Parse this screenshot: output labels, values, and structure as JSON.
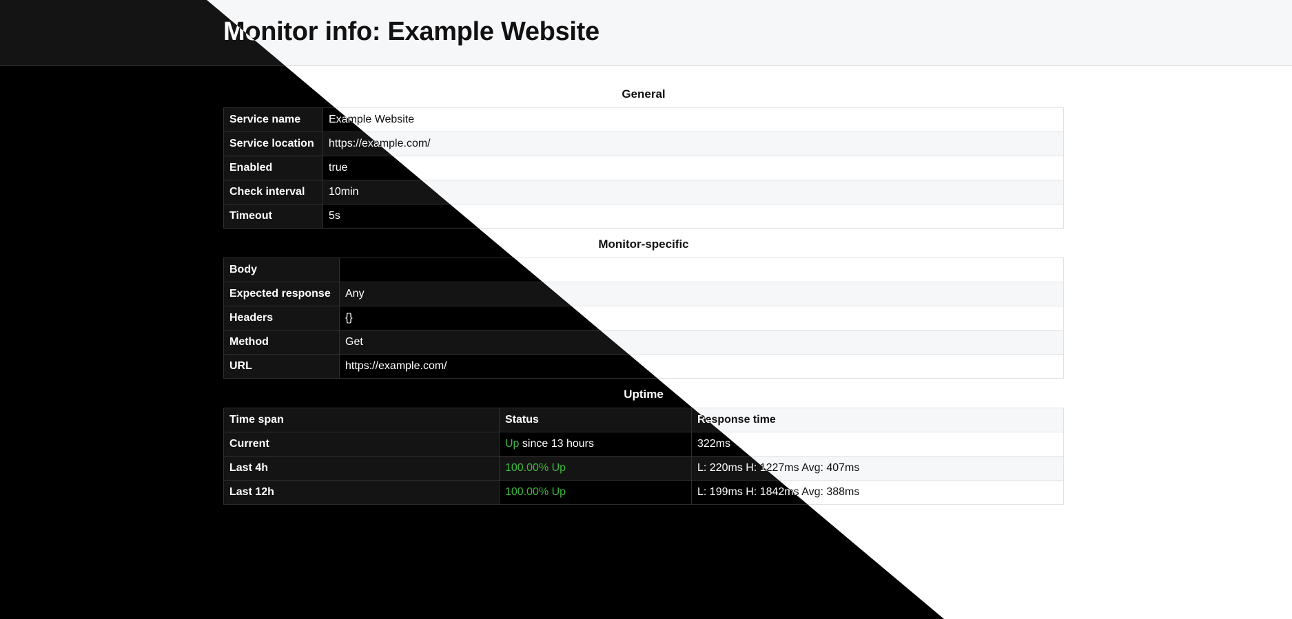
{
  "page": {
    "title": "Monitor info: Example Website"
  },
  "general": {
    "heading": "General",
    "rows": [
      {
        "label": "Service name",
        "value": "Example Website"
      },
      {
        "label": "Service location",
        "value": "https://example.com/"
      },
      {
        "label": "Enabled",
        "value": "true"
      },
      {
        "label": "Check interval",
        "value": "10min"
      },
      {
        "label": "Timeout",
        "value": "5s"
      }
    ]
  },
  "monitor_specific": {
    "heading": "Monitor-specific",
    "rows": [
      {
        "label": "Body",
        "value": ""
      },
      {
        "label": "Expected response",
        "value": "Any"
      },
      {
        "label": "Headers",
        "value": "{}"
      },
      {
        "label": "Method",
        "value": "Get"
      },
      {
        "label": "URL",
        "value": "https://example.com/"
      }
    ]
  },
  "uptime": {
    "heading": "Uptime",
    "columns": [
      "Time span",
      "Status",
      "Response time"
    ],
    "rows": [
      {
        "span": "Current",
        "status_up": "Up",
        "status_rest": " since 13 hours",
        "response": "322ms"
      },
      {
        "span": "Last 4h",
        "status_up": "100.00% Up",
        "status_rest": "",
        "response": "L: 220ms H: 1227ms Avg: 407ms"
      },
      {
        "span": "Last 12h",
        "status_up": "100.00% Up",
        "status_rest": "",
        "response": "L: 199ms H: 1842ms Avg: 388ms"
      }
    ]
  },
  "colors": {
    "up_green": "#3cba3c",
    "light_bg": "#ffffff",
    "dark_bg": "#000000"
  }
}
